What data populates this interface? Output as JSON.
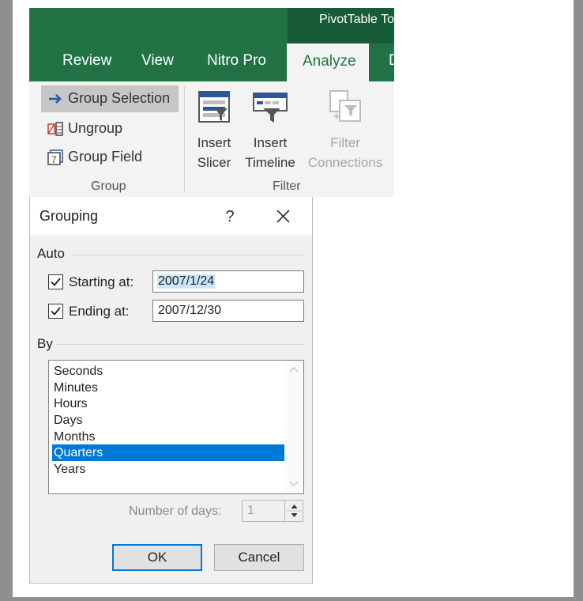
{
  "ribbon": {
    "contextual_label": "PivotTable To",
    "tabs": [
      {
        "label": "Review"
      },
      {
        "label": "View"
      },
      {
        "label": "Nitro Pro"
      },
      {
        "label": "Analyze",
        "active": true
      },
      {
        "label": "D"
      }
    ],
    "group_group": {
      "caption": "Group",
      "buttons": [
        {
          "label": "Group Selection",
          "icon": "arrow-right-icon",
          "selected": true
        },
        {
          "label": "Ungroup",
          "icon": "ungroup-icon"
        },
        {
          "label": "Group Field",
          "icon": "group-field-icon"
        }
      ]
    },
    "filter_group": {
      "caption": "Filter",
      "buttons": [
        {
          "line1": "Insert",
          "line2": "Slicer",
          "icon": "slicer-icon"
        },
        {
          "line1": "Insert",
          "line2": "Timeline",
          "icon": "timeline-icon"
        },
        {
          "line1": "Filter",
          "line2": "Connections",
          "icon": "filter-connections-icon",
          "disabled": true
        }
      ]
    }
  },
  "dialog": {
    "title": "Grouping",
    "help": "?",
    "auto_label": "Auto",
    "starting": {
      "label": "Starting at:",
      "checked": true,
      "value": "2007/1/24"
    },
    "ending": {
      "label": "Ending at:",
      "checked": true,
      "value": "2007/12/30"
    },
    "by_label": "By",
    "by_options": [
      "Seconds",
      "Minutes",
      "Hours",
      "Days",
      "Months",
      "Quarters",
      "Years"
    ],
    "selected_option": "Quarters",
    "days_label": "Number of days:",
    "days_value": "1",
    "ok_label": "OK",
    "cancel_label": "Cancel"
  },
  "colors": {
    "excel_green": "#217346",
    "contextual_green": "#185c37",
    "selection_blue": "#0078d7"
  }
}
